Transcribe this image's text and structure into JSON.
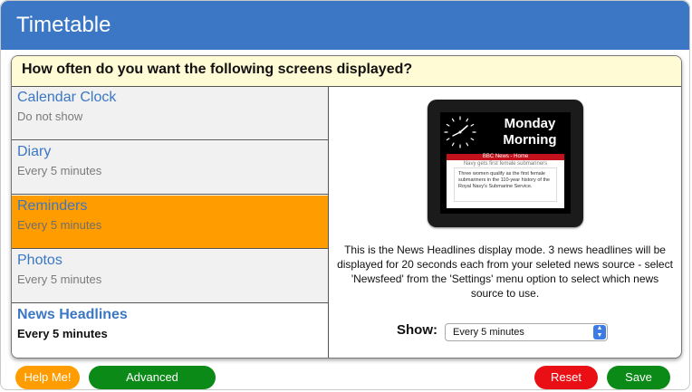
{
  "window": {
    "title": "Timetable"
  },
  "question": "How often do you want the following screens displayed?",
  "screens": [
    {
      "name": "Calendar Clock",
      "frequency": "Do not show"
    },
    {
      "name": "Diary",
      "frequency": "Every 5 minutes"
    },
    {
      "name": "Reminders",
      "frequency": "Every 5 minutes"
    },
    {
      "name": "Photos",
      "frequency": "Every 5 minutes"
    },
    {
      "name": "News Headlines",
      "frequency": "Every 5 minutes"
    }
  ],
  "preview": {
    "day_line1": "Monday",
    "day_line2": "Morning",
    "news_header": "BBC News - Home",
    "news_title": "Navy gets first female submariners",
    "news_body": "Three women qualify as the first female submariners in the 110-year history of the Royal Navy's Submarine Service.",
    "description": "This is the News Headlines display mode. 3 news headlines will be displayed for 20 seconds each from your seleted news source - select 'Newsfeed' from the 'Settings' menu option to select which news source to use."
  },
  "show": {
    "label": "Show:",
    "value": "Every 5 minutes"
  },
  "buttons": {
    "help": "Help Me!",
    "advanced": "Advanced",
    "reset": "Reset",
    "save": "Save"
  },
  "colors": {
    "titlebar": "#3b77c4",
    "selected_row": "#ff9d00",
    "question_bg": "#fffbd5",
    "help": "#ff9c00",
    "green": "#0b8a17",
    "reset": "#ea0f14"
  }
}
